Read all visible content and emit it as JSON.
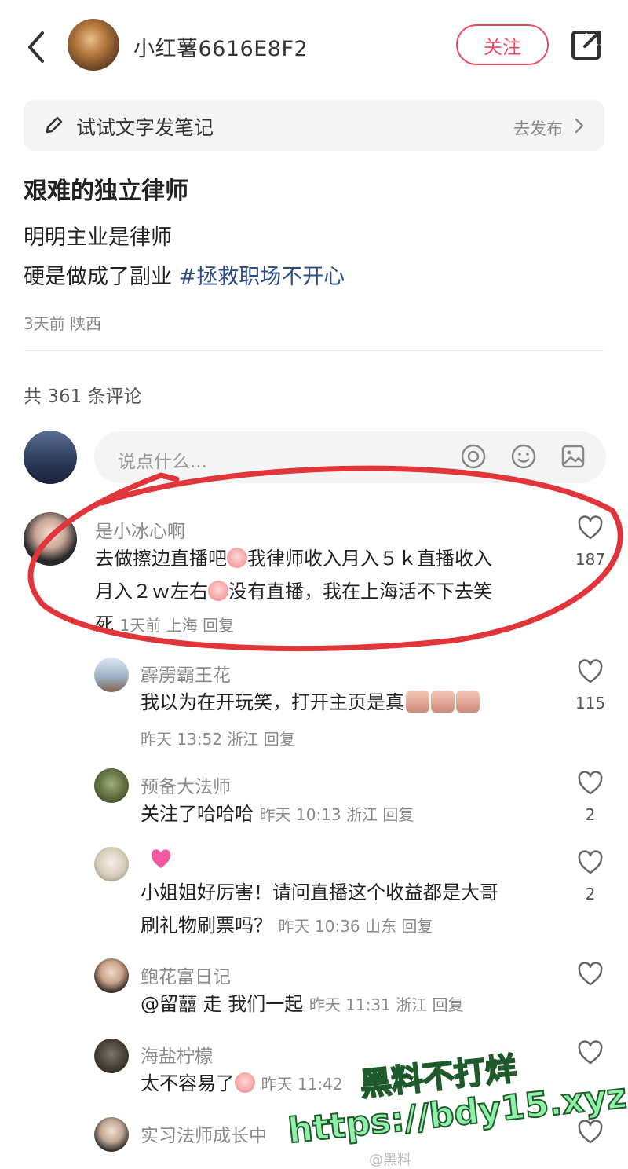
{
  "header": {
    "author_name": "小红薯6616E8F2",
    "follow_label": "关注"
  },
  "tip_bar": {
    "text": "试试文字发笔记",
    "action": "去发布"
  },
  "note": {
    "title": "艰难的独立律师",
    "line1": "明明主业是律师",
    "line2_prefix": "硬是做成了副业 ",
    "hashtag": "#拯救职场不开心",
    "time": "3天前",
    "location": "陕西"
  },
  "comments_count": "共 361 条评论",
  "input": {
    "placeholder": "说点什么..."
  },
  "comments": [
    {
      "name": "是小冰心啊",
      "text_a": "去做擦边直播吧",
      "text_b": "我律师收入月入５ｋ直播收入",
      "text_c": "月入２ｗ左右",
      "text_d": "没有直播，我在上海活不下去笑",
      "text_e": "死",
      "meta": "1天前 上海 回复",
      "likes": "187"
    },
    {
      "name": "霹雳霸王花",
      "text": "我以为在开玩笑，打开主页是真",
      "meta": "昨天 13:52 浙江 回复",
      "likes": "115"
    },
    {
      "name": "预备大法师",
      "text": "关注了哈哈哈",
      "meta": "昨天 10:13 浙江 回复",
      "likes": "2"
    },
    {
      "name": "",
      "text_a": "小姐姐好厉害！请问直播这个收益都是大哥",
      "text_b": "刷礼物刷票吗？",
      "meta": "昨天 10:36 山东 回复",
      "likes": "2"
    },
    {
      "name": "鲍花富日记",
      "text": "@留囍 走 我们一起",
      "meta": "昨天 11:31 浙江 回复",
      "likes": ""
    },
    {
      "name": "海盐柠檬",
      "text": "太不容易了",
      "meta": "昨天 11:42",
      "likes": ""
    },
    {
      "name": "实习法师成长中",
      "text": "",
      "meta": "",
      "likes": ""
    }
  ],
  "watermark": {
    "line1": "黑料不打烊",
    "line2": "https://bdy15.xyz",
    "weibo": "@黑料"
  },
  "colors": {
    "accent": "#ef4a5d",
    "hashtag": "#2b4b82",
    "annotation_circle": "#e0353a",
    "watermark_text": "#8ff0a8"
  }
}
